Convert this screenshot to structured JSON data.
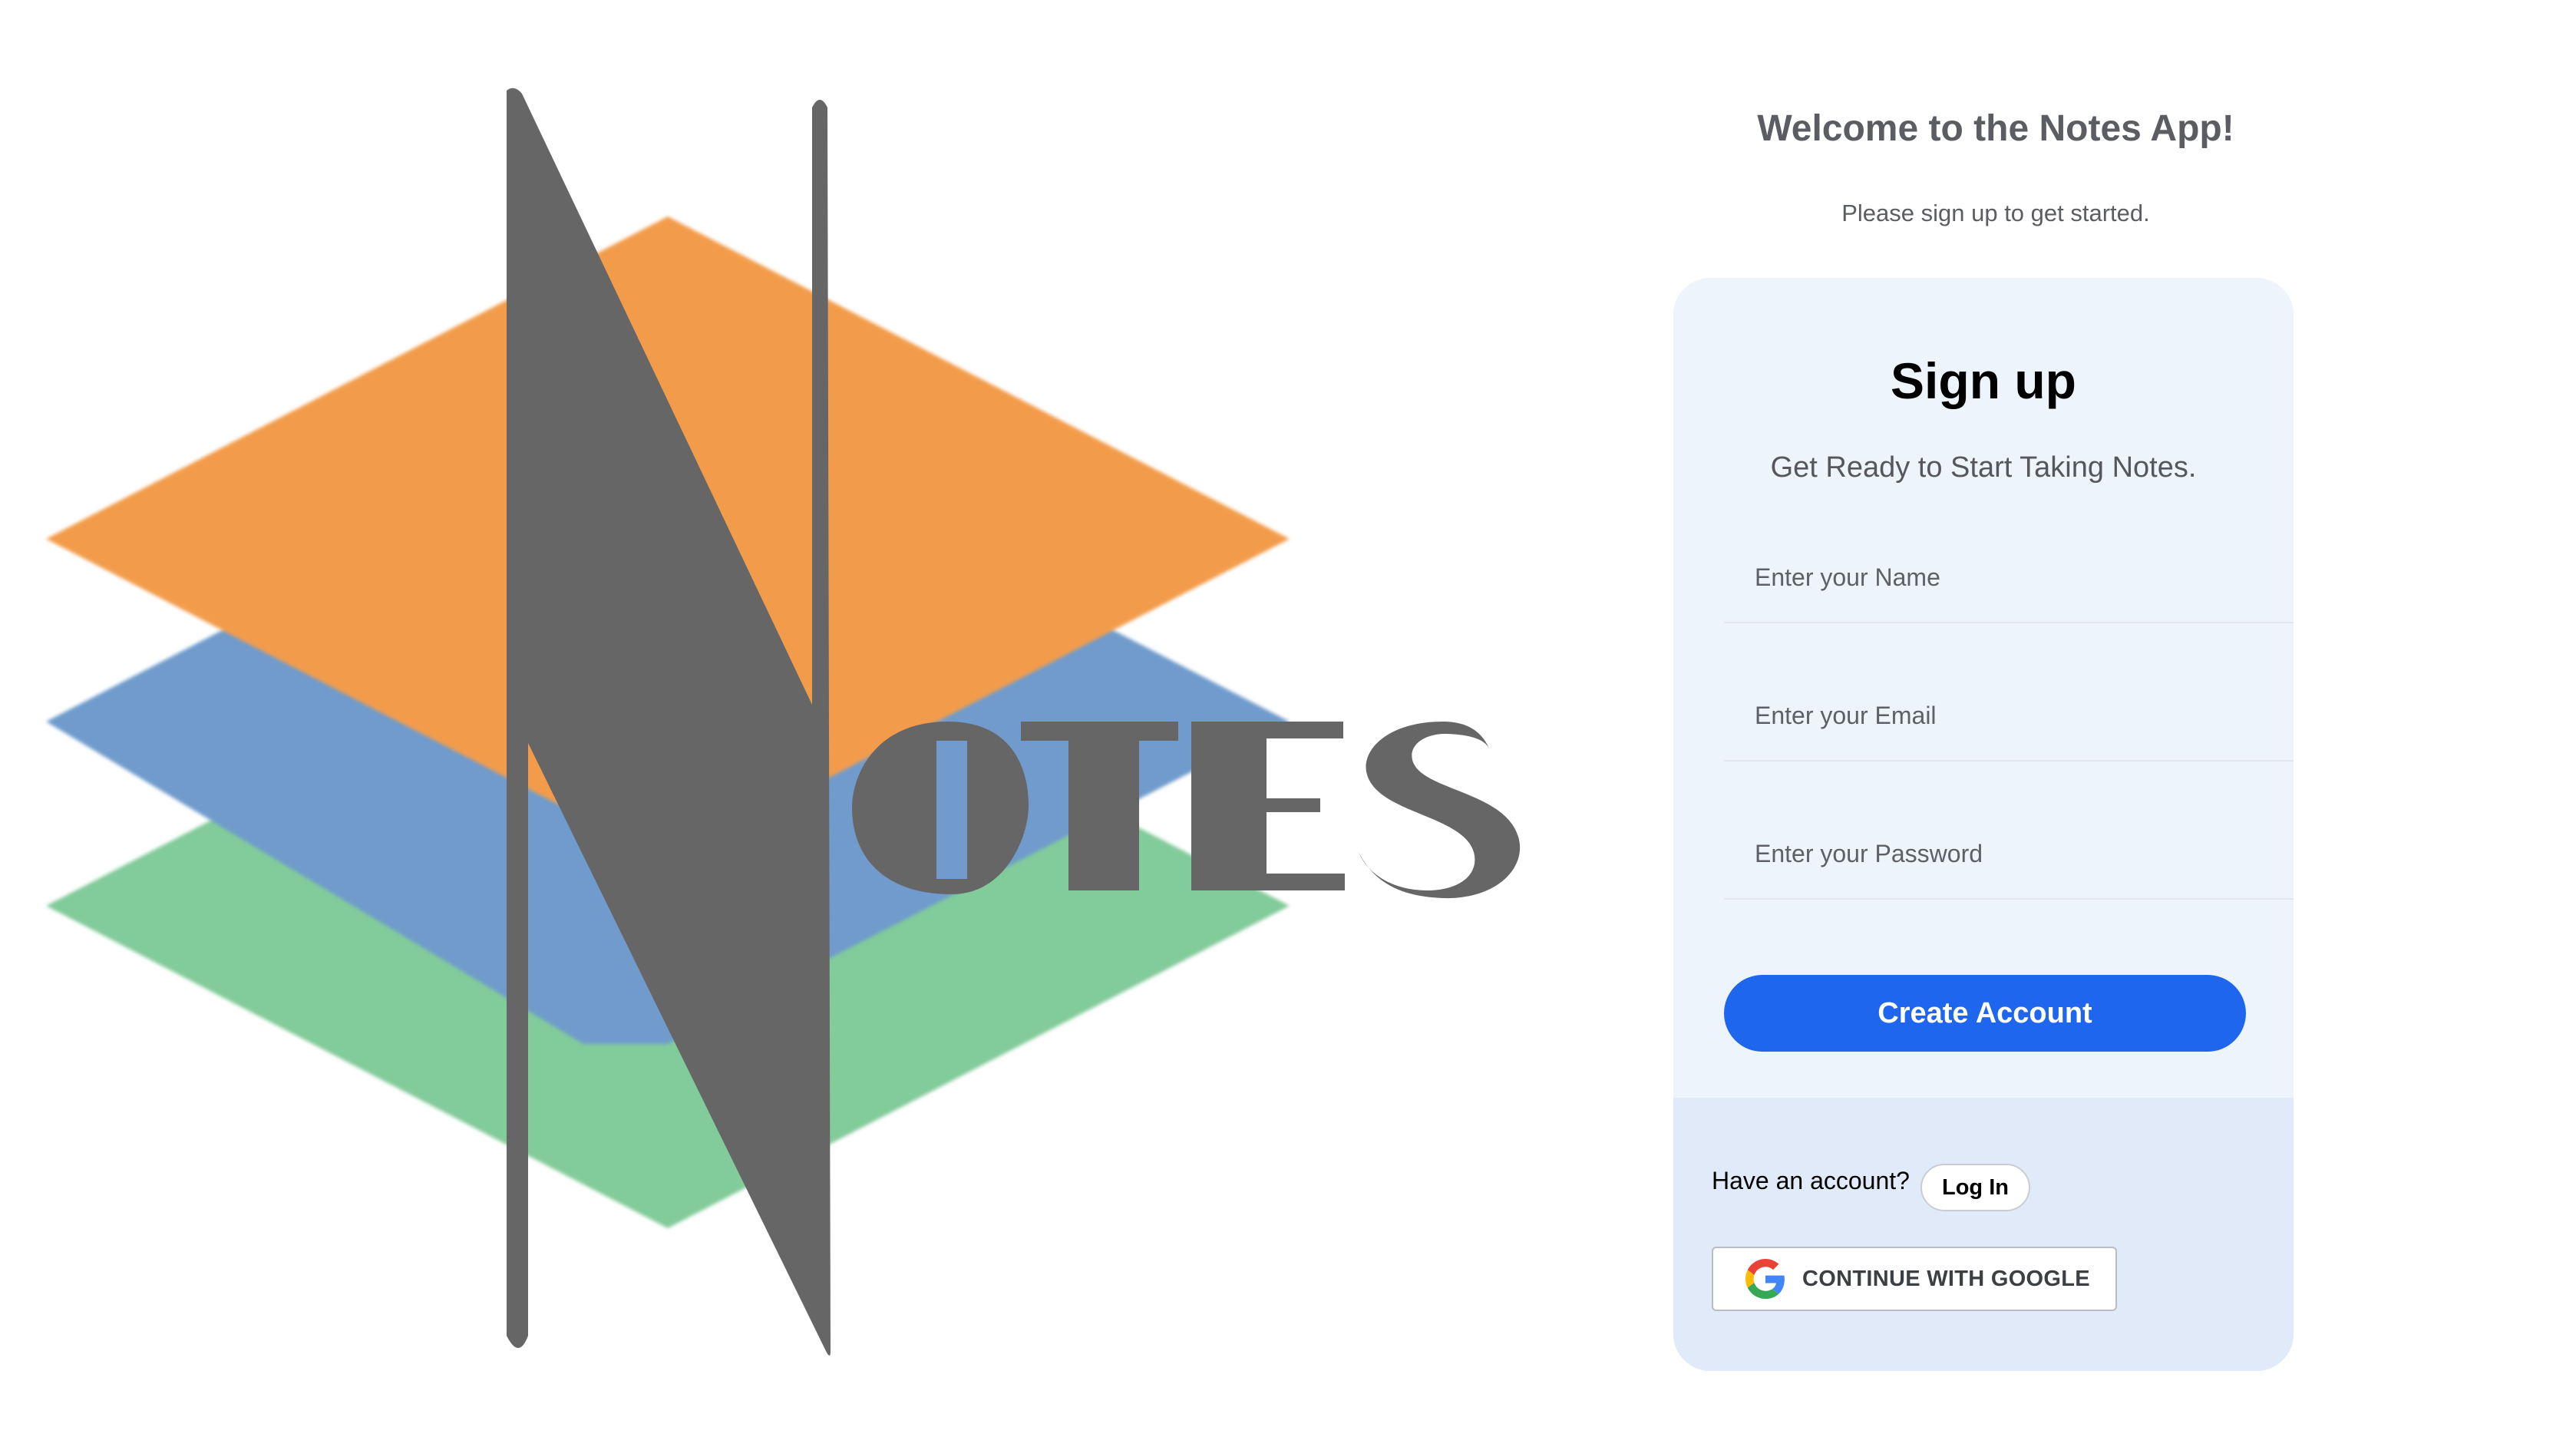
{
  "logo": {
    "letters": "OTES",
    "colors": {
      "orange": "#f29c4b",
      "blue": "#6f9bcc",
      "green": "#82cb9a",
      "gray": "#666666"
    }
  },
  "welcome": {
    "title": "Welcome to the Notes App!",
    "subtitle": "Please sign up to get started."
  },
  "signup": {
    "title": "Sign up",
    "subtitle": "Get Ready to Start Taking Notes.",
    "fields": {
      "name_placeholder": "Enter your Name",
      "email_placeholder": "Enter your Email",
      "password_placeholder": "Enter your Password"
    },
    "create_account_label": "Create Account",
    "have_account_text": "Have an account?",
    "login_label": "Log In",
    "google_label": "CONTINUE WITH GOOGLE",
    "accent_color": "#1f66ee"
  }
}
